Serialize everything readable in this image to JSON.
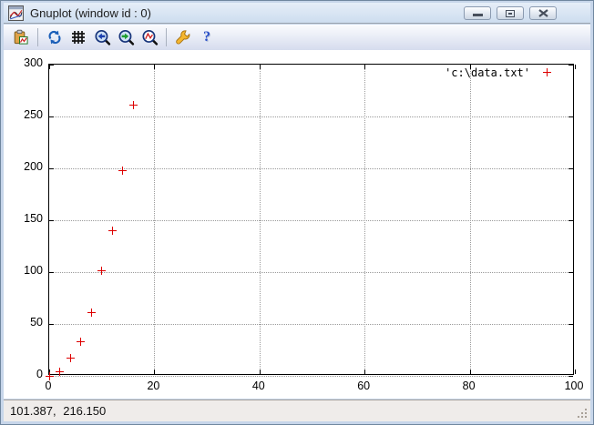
{
  "window": {
    "title": "Gnuplot (window id : 0)",
    "controls": [
      "minimize",
      "maximize",
      "close"
    ]
  },
  "toolbar": {
    "icon_names": [
      "copy-to-clipboard",
      "replot",
      "grid-toggle",
      "zoom-previous",
      "zoom-next",
      "zoom-reset",
      "options-wrench",
      "help"
    ],
    "help_glyph": "?"
  },
  "statusbar": {
    "coordinates": "101.387, 216.150"
  },
  "chart_data": {
    "type": "scatter",
    "title": "",
    "xlabel": "",
    "ylabel": "",
    "xlim": [
      0,
      100
    ],
    "ylim": [
      0,
      300
    ],
    "xticks": [
      0,
      20,
      40,
      60,
      80,
      100
    ],
    "yticks": [
      0,
      50,
      100,
      150,
      200,
      250,
      300
    ],
    "grid": true,
    "legend_position": "top-right",
    "series": [
      {
        "name": "'c:\\data.txt'",
        "marker": "+",
        "color": "#dd0000",
        "points": [
          [
            0,
            0
          ],
          [
            2,
            4
          ],
          [
            4,
            17
          ],
          [
            6,
            33
          ],
          [
            8,
            61
          ],
          [
            10,
            101
          ],
          [
            12,
            140
          ],
          [
            14,
            198
          ],
          [
            16,
            261
          ]
        ]
      }
    ]
  }
}
